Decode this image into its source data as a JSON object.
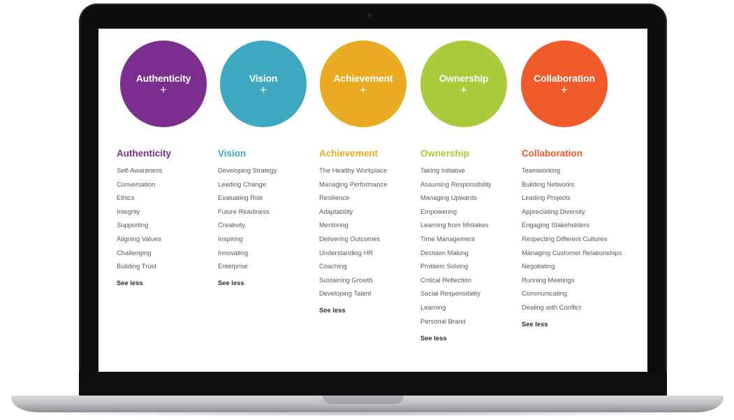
{
  "colors": {
    "authenticity": "#7a2e8e",
    "vision": "#3fa7bf",
    "achievement": "#eaab22",
    "ownership": "#a9cb3b",
    "collaboration": "#f15a2b"
  },
  "circles": [
    {
      "title": "Authenticity",
      "plus": "+"
    },
    {
      "title": "Vision",
      "plus": "+"
    },
    {
      "title": "Achievement",
      "plus": "+"
    },
    {
      "title": "Ownership",
      "plus": "+"
    },
    {
      "title": "Collaboration",
      "plus": "+"
    }
  ],
  "columns": [
    {
      "heading": "Authenticity",
      "items": [
        "Self-Awareness",
        "Conversation",
        "Ethics",
        "Integrity",
        "Supporting",
        "Aligning Values",
        "Challenging",
        "Building Trust"
      ],
      "see_less": "See less"
    },
    {
      "heading": "Vision",
      "items": [
        "Developing Strategy",
        "Leading Change",
        "Evaluating Risk",
        "Future Readiness",
        "Creativity",
        "Inspiring",
        "Innovating",
        "Enterprise"
      ],
      "see_less": "See less"
    },
    {
      "heading": "Achievement",
      "items": [
        "The Healthy Workplace",
        "Managing Performance",
        "Resilience",
        "Adaptability",
        "Mentoring",
        "Delivering Outcomes",
        "Understanding HR",
        "Coaching",
        "Sustaining Growth",
        "Developing Talent"
      ],
      "see_less": "See less"
    },
    {
      "heading": "Ownership",
      "items": [
        "Taking Initiative",
        "Assuming Responsibility",
        "Managing Upwards",
        "Empowering",
        "Learning from Mistakes",
        "Time Management",
        "Decision Making",
        "Problem Solving",
        "Critical Reflection",
        "Social Responsibility",
        "Learning",
        "Personal Brand"
      ],
      "see_less": "See less"
    },
    {
      "heading": "Collaboration",
      "items": [
        "Teamworking",
        "Building Networks",
        "Leading Projects",
        "Appreciating Diversity",
        "Engaging Stakeholders",
        "Respecting Different Cultures",
        "Managing Customer Relationships",
        "Negotiating",
        "Running Meetings",
        "Communicating",
        "Dealing with Conflict"
      ],
      "see_less": "See less"
    }
  ]
}
